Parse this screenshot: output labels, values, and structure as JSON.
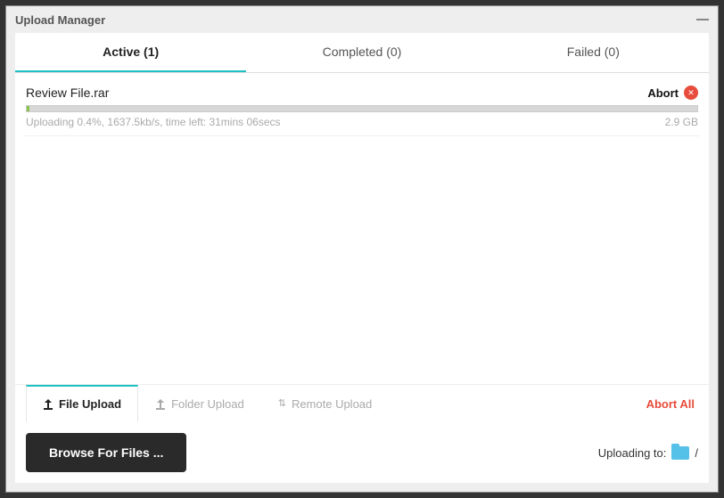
{
  "window": {
    "title": "Upload Manager"
  },
  "tabs": {
    "active": {
      "label": "Active (1)"
    },
    "completed": {
      "label": "Completed (0)"
    },
    "failed": {
      "label": "Failed (0)"
    }
  },
  "upload": {
    "filename": "Review File.rar",
    "abort_label": "Abort",
    "progress_percent": 0.4,
    "status_text": "Uploading 0.4%, 1637.5kb/s, time left: 31mins 06secs",
    "size_text": "2.9 GB"
  },
  "bottom_tabs": {
    "file": {
      "label": "File Upload"
    },
    "folder": {
      "label": "Folder Upload"
    },
    "remote": {
      "label": "Remote Upload"
    }
  },
  "abort_all_label": "Abort All",
  "browse_label": "Browse For Files ...",
  "uploading_to_label": "Uploading to:",
  "uploading_to_path": "/"
}
